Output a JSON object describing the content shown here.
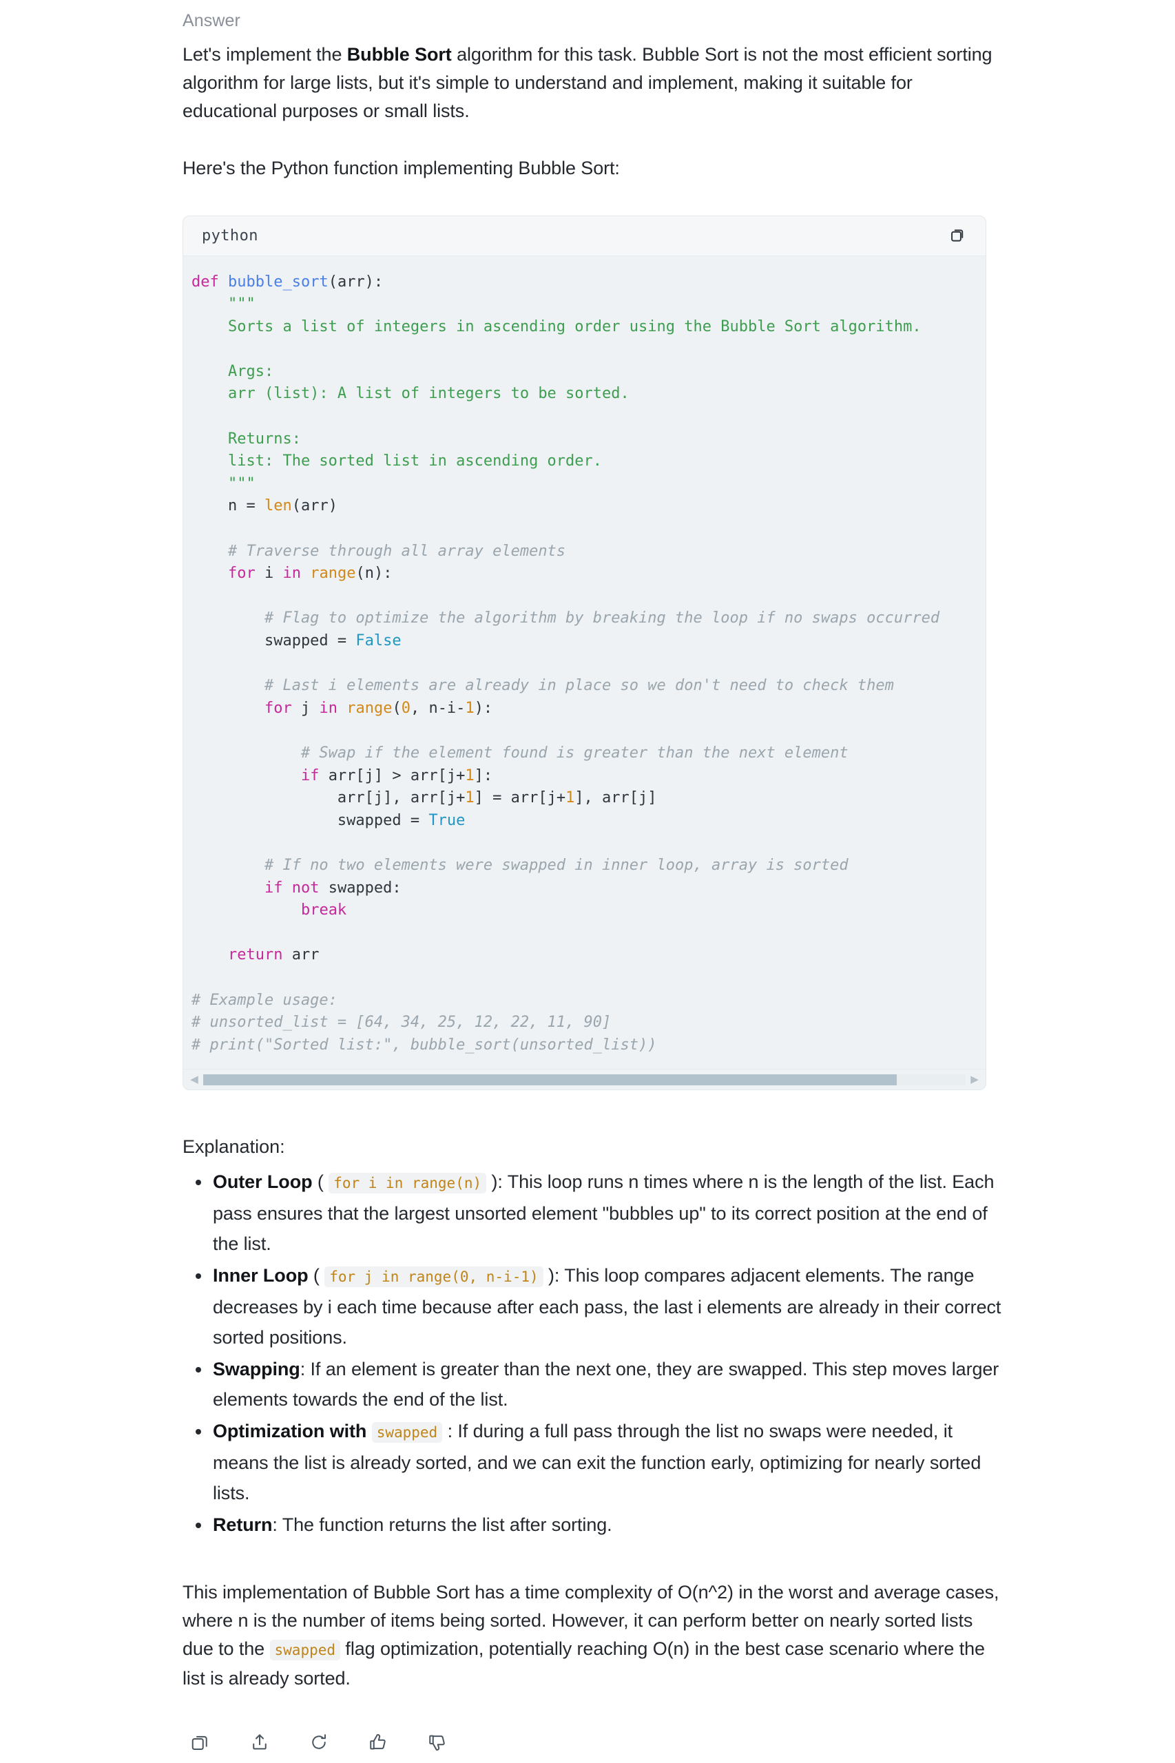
{
  "answer": {
    "label": "Answer",
    "intro_html": "Let's implement the <b>Bubble Sort</b> algorithm for this task. Bubble Sort is not the most efficient sorting algorithm for large lists, but it's simple to understand and implement, making it suitable for educational purposes or small lists.",
    "lead_in": "Here's the Python function implementing Bubble Sort:"
  },
  "code_block": {
    "language": "python",
    "copy_icon": "copy-icon",
    "scrollbar": {
      "left_arrow_icon": "chevron-left-icon",
      "right_arrow_icon": "chevron-right-icon",
      "thumb_percent": 91
    },
    "code_html": "<span class=\"k\">def</span> <span class=\"fn\">bubble_sort</span><span class=\"pl\">(arr):</span>\n<span class=\"doc\">    \"\"\"\n    Sorts a list of integers in ascending order using the Bubble Sort algorithm.\n\n    Args:\n    arr (list): A list of integers to be sorted.\n\n    Returns:\n    list: The sorted list in ascending order.\n    \"\"\"</span>\n<span class=\"pl\">    n = </span><span class=\"bi\">len</span><span class=\"pl\">(arr)</span>\n\n<span class=\"cm\">    # Traverse through all array elements</span>\n    <span class=\"k\">for</span><span class=\"pl\"> i </span><span class=\"k\">in</span> <span class=\"bi\">range</span><span class=\"pl\">(n):</span>\n\n<span class=\"cm\">        # Flag to optimize the algorithm by breaking the loop if no swaps occurred</span>\n<span class=\"pl\">        swapped = </span><span class=\"cn\">False</span>\n\n<span class=\"cm\">        # Last i elements are already in place so we don't need to check them</span>\n        <span class=\"k\">for</span><span class=\"pl\"> j </span><span class=\"k\">in</span> <span class=\"bi\">range</span><span class=\"pl\">(</span><span class=\"num\">0</span><span class=\"pl\">, n-i-</span><span class=\"num\">1</span><span class=\"pl\">):</span>\n\n<span class=\"cm\">            # Swap if the element found is greater than the next element</span>\n            <span class=\"k\">if</span><span class=\"pl\"> arr[j] &gt; arr[j+</span><span class=\"num\">1</span><span class=\"pl\">]:</span>\n<span class=\"pl\">                arr[j], arr[j+</span><span class=\"num\">1</span><span class=\"pl\">] = arr[j+</span><span class=\"num\">1</span><span class=\"pl\">], arr[j]</span>\n<span class=\"pl\">                swapped = </span><span class=\"cn\">True</span>\n\n<span class=\"cm\">        # If no two elements were swapped in inner loop, array is sorted</span>\n        <span class=\"k\">if not</span><span class=\"pl\"> swapped:</span>\n            <span class=\"k\">break</span>\n\n    <span class=\"k\">return</span><span class=\"pl\"> arr</span>\n\n<span class=\"cm\"># Example usage:\n# unsorted_list = [64, 34, 25, 12, 22, 11, 90]\n# print(\"Sorted list:\", bubble_sort(unsorted_list))</span>",
    "code_plain": "def bubble_sort(arr):\n    \"\"\"\n    Sorts a list of integers in ascending order using the Bubble Sort algorithm.\n\n    Args:\n    arr (list): A list of integers to be sorted.\n\n    Returns:\n    list: The sorted list in ascending order.\n    \"\"\"\n    n = len(arr)\n\n    # Traverse through all array elements\n    for i in range(n):\n\n        # Flag to optimize the algorithm by breaking the loop if no swaps occurred\n        swapped = False\n\n        # Last i elements are already in place so we don't need to check them\n        for j in range(0, n-i-1):\n\n            # Swap if the element found is greater than the next element\n            if arr[j] > arr[j+1]:\n                arr[j], arr[j+1] = arr[j+1], arr[j]\n                swapped = True\n\n        # If no two elements were swapped in inner loop, array is sorted\n        if not swapped:\n            break\n\n    return arr\n\n# Example usage:\n# unsorted_list = [64, 34, 25, 12, 22, 11, 90]\n# print(\"Sorted list:\", bubble_sort(unsorted_list))"
  },
  "explanation": {
    "title": "Explanation:",
    "bullets": [
      {
        "html": "<b>Outer Loop</b> ( <code class=\"inline\">for i in range(n)</code> ): This loop runs n times where n is the length of the list. Each pass ensures that the largest unsorted element \"bubbles up\" to its correct position at the end of the list."
      },
      {
        "html": "<b>Inner Loop</b> ( <code class=\"inline\">for j in range(0, n-i-1)</code> ): This loop compares adjacent elements. The range decreases by i each time because after each pass, the last i elements are already in their correct sorted positions."
      },
      {
        "html": "<b>Swapping</b>: If an element is greater than the next one, they are swapped. This step moves larger elements towards the end of the list."
      },
      {
        "html": "<b>Optimization with</b> <code class=\"inline\">swapped</code> : If during a full pass through the list no swaps were needed, it means the list is already sorted, and we can exit the function early, optimizing for nearly sorted lists."
      },
      {
        "html": "<b>Return</b>: The function returns the list after sorting."
      }
    ]
  },
  "closing": {
    "html": "This implementation of Bubble Sort has a time complexity of O(n^2) in the worst and average cases, where n is the number of items being sorted. However, it can perform better on nearly sorted lists due to the <code class=\"inline\">swapped</code> flag optimization, potentially reaching O(n) in the best case scenario where the list is already sorted."
  },
  "actions": [
    {
      "name": "copy-icon",
      "title": "Copy"
    },
    {
      "name": "share-icon",
      "title": "Share"
    },
    {
      "name": "regenerate-icon",
      "title": "Regenerate"
    },
    {
      "name": "thumbs-up-icon",
      "title": "Good response"
    },
    {
      "name": "thumbs-down-icon",
      "title": "Bad response"
    }
  ],
  "colors": {
    "page_background": "#ffffff",
    "code_background": "#eef2f4",
    "code_header_background": "#f5f7f8",
    "text": "#24292f",
    "muted_label": "#8a9099",
    "inline_code_text": "#c08419",
    "inline_code_background": "#f0f2f3",
    "keyword": "#c5299b",
    "function_name": "#4a7ee8",
    "builtin": "#d2891a",
    "docstring": "#3e9e50",
    "comment": "#9aa5ad",
    "constant": "#2196c4",
    "scrollbar_thumb": "#b2c2cc",
    "scrollbar_track": "#e9eef0"
  }
}
